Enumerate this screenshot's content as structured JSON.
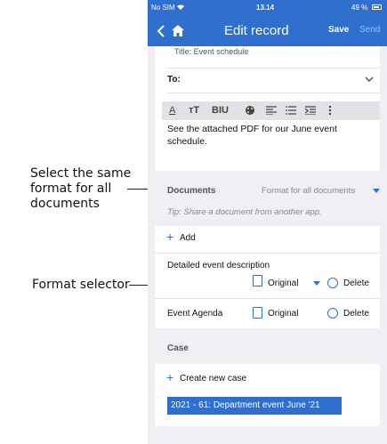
{
  "annotations": {
    "format_all_line1": "Select the same",
    "format_all_line2": "format for all",
    "format_all_line3": "documents",
    "format_selector": "Format selector"
  },
  "status_bar": {
    "carrier": "No SIM",
    "time": "13.14",
    "battery": "49 %"
  },
  "nav": {
    "title": "Edit record",
    "save": "Save",
    "send": "Send"
  },
  "email": {
    "title_row": "Title: Event schedule",
    "to_label": "To:",
    "toolbar": {
      "font_color": "A",
      "text_size": "тT",
      "bold_italic_underline": "BIU"
    },
    "body": "See the attached PDF for our June event schedule."
  },
  "documents": {
    "header": "Documents",
    "format_all": "Format for all documents",
    "tip": "Tip: Share a document from another app.",
    "add_label": "Add",
    "items": [
      {
        "name": "Detailed event description",
        "format": "Original",
        "delete": "Delete"
      },
      {
        "name": "Event Agenda",
        "format": "Original",
        "delete": "Delete"
      }
    ]
  },
  "case": {
    "header": "Case",
    "create_label": "Create new case",
    "selected": "2021 - 61: Department event June '21"
  },
  "colors": {
    "accent": "#2f6fce",
    "background": "#efeff4"
  }
}
